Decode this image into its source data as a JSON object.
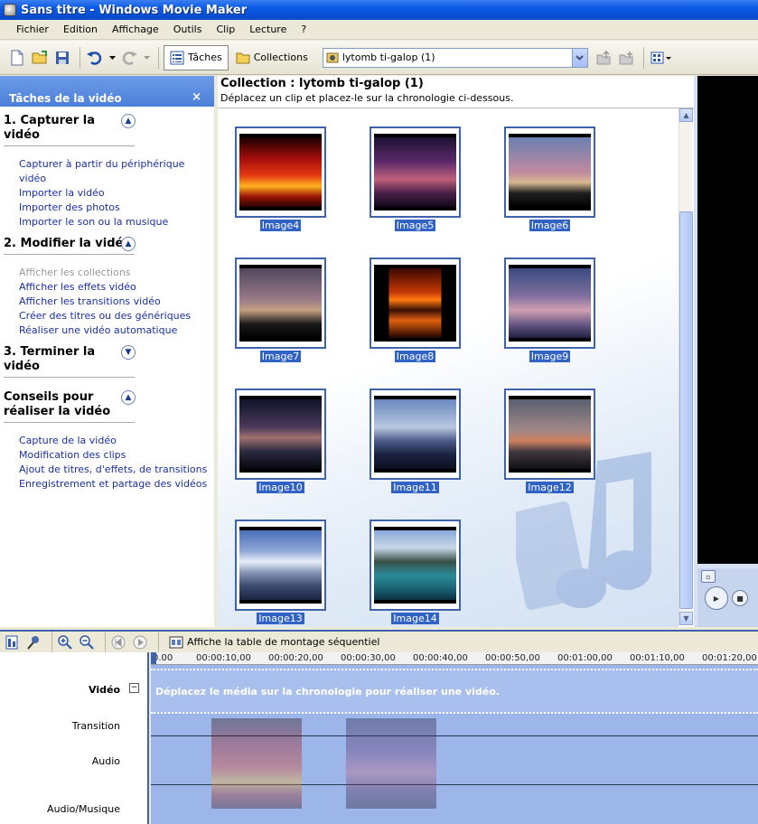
{
  "window": {
    "title": "Sans titre - Windows Movie Maker"
  },
  "menu": [
    "Fichier",
    "Edition",
    "Affichage",
    "Outils",
    "Clip",
    "Lecture",
    "?"
  ],
  "toolbar": {
    "tasks_label": "Tâches",
    "collections_label": "Collections",
    "collection_selected": "lytomb ti-galop (1)"
  },
  "taskpane": {
    "title": "Tâches de la vidéo",
    "close": "×",
    "sections": [
      {
        "title": "1. Capturer la vidéo",
        "toggle": "up",
        "links": [
          "Capturer à partir du périphérique vidéo",
          "Importer la vidéo",
          "Importer des photos",
          "Importer le son ou la musique"
        ]
      },
      {
        "title": "2. Modifier la vidéo",
        "toggle": "up",
        "links": [
          "Afficher les collections",
          "Afficher les effets vidéo",
          "Afficher les transitions vidéo",
          "Créer des titres ou des génériques",
          "Réaliser une vidéo automatique"
        ]
      },
      {
        "title": "3. Terminer la vidéo",
        "toggle": "down",
        "links": []
      },
      {
        "title": "Conseils pour réaliser la vidéo",
        "toggle": "up",
        "links": [
          "Capture de la vidéo",
          "Modification des clips",
          "Ajout de titres, d'effets, de transitions",
          "Enregistrement et partage des vidéos"
        ]
      }
    ]
  },
  "collection": {
    "title": "Collection : lytomb ti-galop (1)",
    "subtitle": "Déplacez un clip et placez-le sur la chronologie ci-dessous.",
    "items": [
      "Image4",
      "Image5",
      "Image6",
      "Image7",
      "Image8",
      "Image9",
      "Image10",
      "Image11",
      "Image12",
      "Image13",
      "Image14"
    ]
  },
  "storyboard": {
    "toggle_label": "Affiche la table de montage séquentiel",
    "ruler": [
      "0.00",
      "00:00:10,00",
      "00:00:20,00",
      "00:00:30,00",
      "00:00:40,00",
      "00:00:50,00",
      "00:01:00,00",
      "00:01:10,00",
      "00:01:20,00"
    ],
    "tracks": [
      "Vidéo",
      "Transition",
      "Audio",
      "Audio/Musique"
    ],
    "video_message": "Déplacez le média sur la chronologie pour réaliser une vidéo."
  },
  "colors": {
    "accent": "#3e63ac",
    "link": "#1a2fa0",
    "selection": "#3163c5"
  }
}
